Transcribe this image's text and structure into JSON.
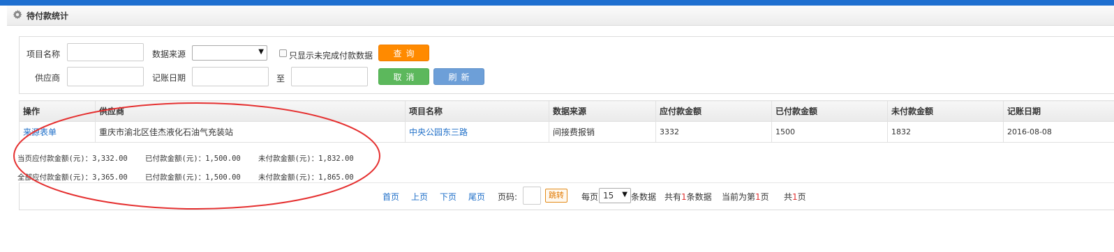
{
  "panel": {
    "title": "待付款统计",
    "icon": "gear-icon"
  },
  "filters": {
    "project_name_label": "项目名称",
    "data_source_label": "数据来源",
    "data_source_value": "",
    "only_unfinished_label": "只显示未完成付款数据",
    "supplier_label": "供应商",
    "date_label": "记账日期",
    "to_label": "至",
    "query_button": "查询",
    "cancel_button": "取消",
    "refresh_button": "刷新"
  },
  "table": {
    "headers": [
      "操作",
      "供应商",
      "项目名称",
      "数据来源",
      "应付款金额",
      "已付款金额",
      "未付款金额",
      "记账日期"
    ],
    "rows": [
      [
        "来源表单",
        "重庆市渝北区佳杰液化石油气充装站",
        "中央公园东三路",
        "间接费报销",
        "3332",
        "1500",
        "1832",
        "2016-08-08"
      ]
    ]
  },
  "summary": {
    "page_line": "当页应付款金额(元)：3,332.00    已付款金额(元)：1,500.00    未付款金额(元)：1,832.00",
    "total_line": "全部应付款金额(元)：3,365.00    已付款金额(元)：1,500.00    未付款金额(元)：1,865.00"
  },
  "pager": {
    "first": "首页",
    "prev": "上页",
    "next": "下页",
    "last": "尾页",
    "page_label": "页码:",
    "jump": "跳转",
    "per_page_prefix": "每页",
    "per_page_value": "15",
    "per_page_suffix": "条数据",
    "total_prefix": "共有",
    "total_count": "1",
    "total_suffix": "条数据",
    "current_prefix": "当前为第",
    "current_page": "1",
    "current_suffix": "页",
    "pages_prefix": "共",
    "pages_count": "1",
    "pages_suffix": "页"
  },
  "colors": {
    "top_bar": "#1e6fd0",
    "query_button": "#ff8a00",
    "cancel_button": "#5cb85c",
    "refresh_button": "#6d9fd8",
    "link": "#1f6fc8",
    "annotation": "#e53030"
  }
}
